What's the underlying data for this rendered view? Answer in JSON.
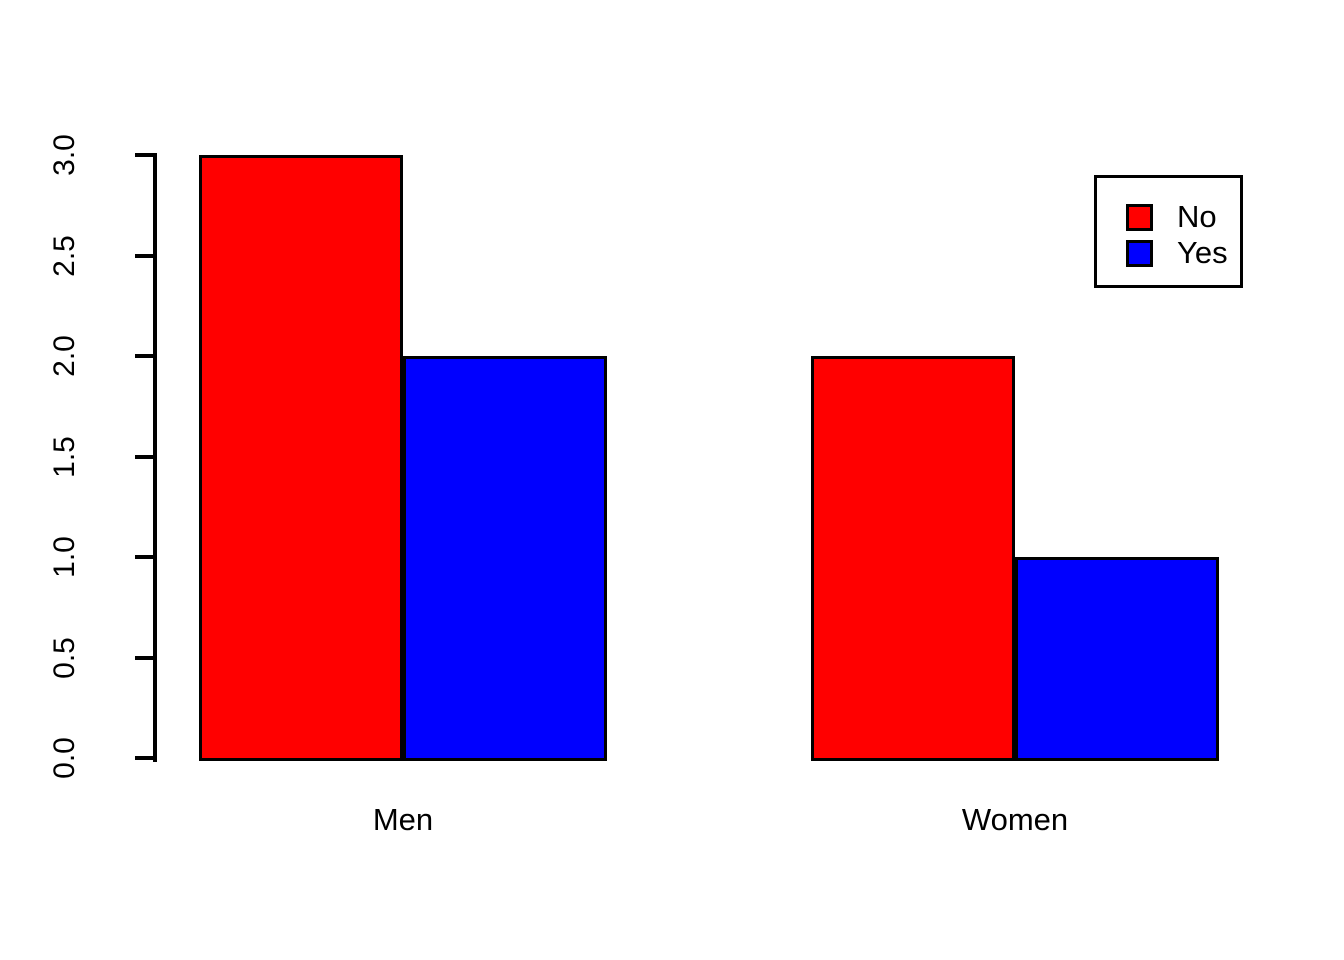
{
  "chart_data": {
    "type": "bar",
    "title": "",
    "subtitle": "",
    "xlabel": "",
    "ylabel": "",
    "categories": [
      "Men",
      "Women"
    ],
    "series": [
      {
        "name": "No",
        "color": "#FF0000",
        "values": [
          3,
          2
        ]
      },
      {
        "name": "Yes",
        "color": "#0000FF",
        "values": [
          2,
          1
        ]
      }
    ],
    "ylim": [
      0,
      3
    ],
    "y_ticks": [
      0,
      0.5,
      1,
      1.5,
      2,
      2.5,
      3
    ],
    "y_tick_labels": [
      "0.0",
      "0.5",
      "1.0",
      "1.5",
      "2.0",
      "2.5",
      "3.0"
    ],
    "grid": false,
    "beside": true,
    "legend": {
      "position": "top-right",
      "entries": [
        {
          "label": "No",
          "color": "#FF0000"
        },
        {
          "label": "Yes",
          "color": "#0000FF"
        }
      ]
    },
    "bars": [
      {
        "group": "Men",
        "series": "No",
        "value": 3,
        "color": "#FF0000"
      },
      {
        "group": "Men",
        "series": "Yes",
        "value": 2,
        "color": "#0000FF"
      },
      {
        "group": "Women",
        "series": "No",
        "value": 2,
        "color": "#FF0000"
      },
      {
        "group": "Women",
        "series": "Yes",
        "value": 1,
        "color": "#0000FF"
      }
    ]
  },
  "axis": {
    "y_tick_labels": [
      "0.0",
      "0.5",
      "1.0",
      "1.5",
      "2.0",
      "2.5",
      "3.0"
    ],
    "x_group_labels": [
      "Men",
      "Women"
    ]
  },
  "legend": {
    "entries": [
      {
        "label": "No"
      },
      {
        "label": "Yes"
      }
    ]
  },
  "colors": {
    "no": "#FF0000",
    "yes": "#0000FF",
    "axis": "#000000",
    "background": "#FFFFFF",
    "bar_border": "#000000"
  }
}
